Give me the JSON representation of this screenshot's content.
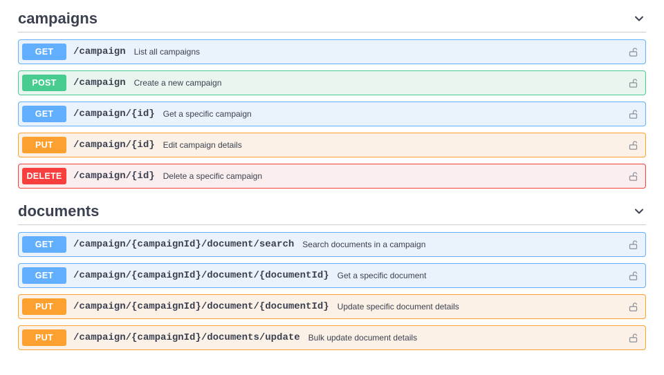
{
  "sections": [
    {
      "name": "campaigns",
      "operations": [
        {
          "method": "GET",
          "path": "/campaign",
          "summary": "List all campaigns",
          "auth": true
        },
        {
          "method": "POST",
          "path": "/campaign",
          "summary": "Create a new campaign",
          "auth": true
        },
        {
          "method": "GET",
          "path": "/campaign/{id}",
          "summary": "Get a specific campaign",
          "auth": true
        },
        {
          "method": "PUT",
          "path": "/campaign/{id}",
          "summary": "Edit campaign details",
          "auth": true
        },
        {
          "method": "DELETE",
          "path": "/campaign/{id}",
          "summary": "Delete a specific campaign",
          "auth": true
        }
      ]
    },
    {
      "name": "documents",
      "operations": [
        {
          "method": "GET",
          "path": "/campaign/{campaignId}/document/search",
          "summary": "Search documents in a campaign",
          "auth": true
        },
        {
          "method": "GET",
          "path": "/campaign/{campaignId}/document/{documentId}",
          "summary": "Get a specific document",
          "auth": true
        },
        {
          "method": "PUT",
          "path": "/campaign/{campaignId}/document/{documentId}",
          "summary": "Update specific document details",
          "auth": true
        },
        {
          "method": "PUT",
          "path": "/campaign/{campaignId}/documents/update",
          "summary": "Bulk update document details",
          "auth": true
        }
      ]
    }
  ],
  "method_styles": {
    "GET": {
      "row": "op-get",
      "badge": "m-get"
    },
    "POST": {
      "row": "op-post",
      "badge": "m-post"
    },
    "PUT": {
      "row": "op-put",
      "badge": "m-put"
    },
    "DELETE": {
      "row": "op-delete",
      "badge": "m-delete"
    }
  }
}
